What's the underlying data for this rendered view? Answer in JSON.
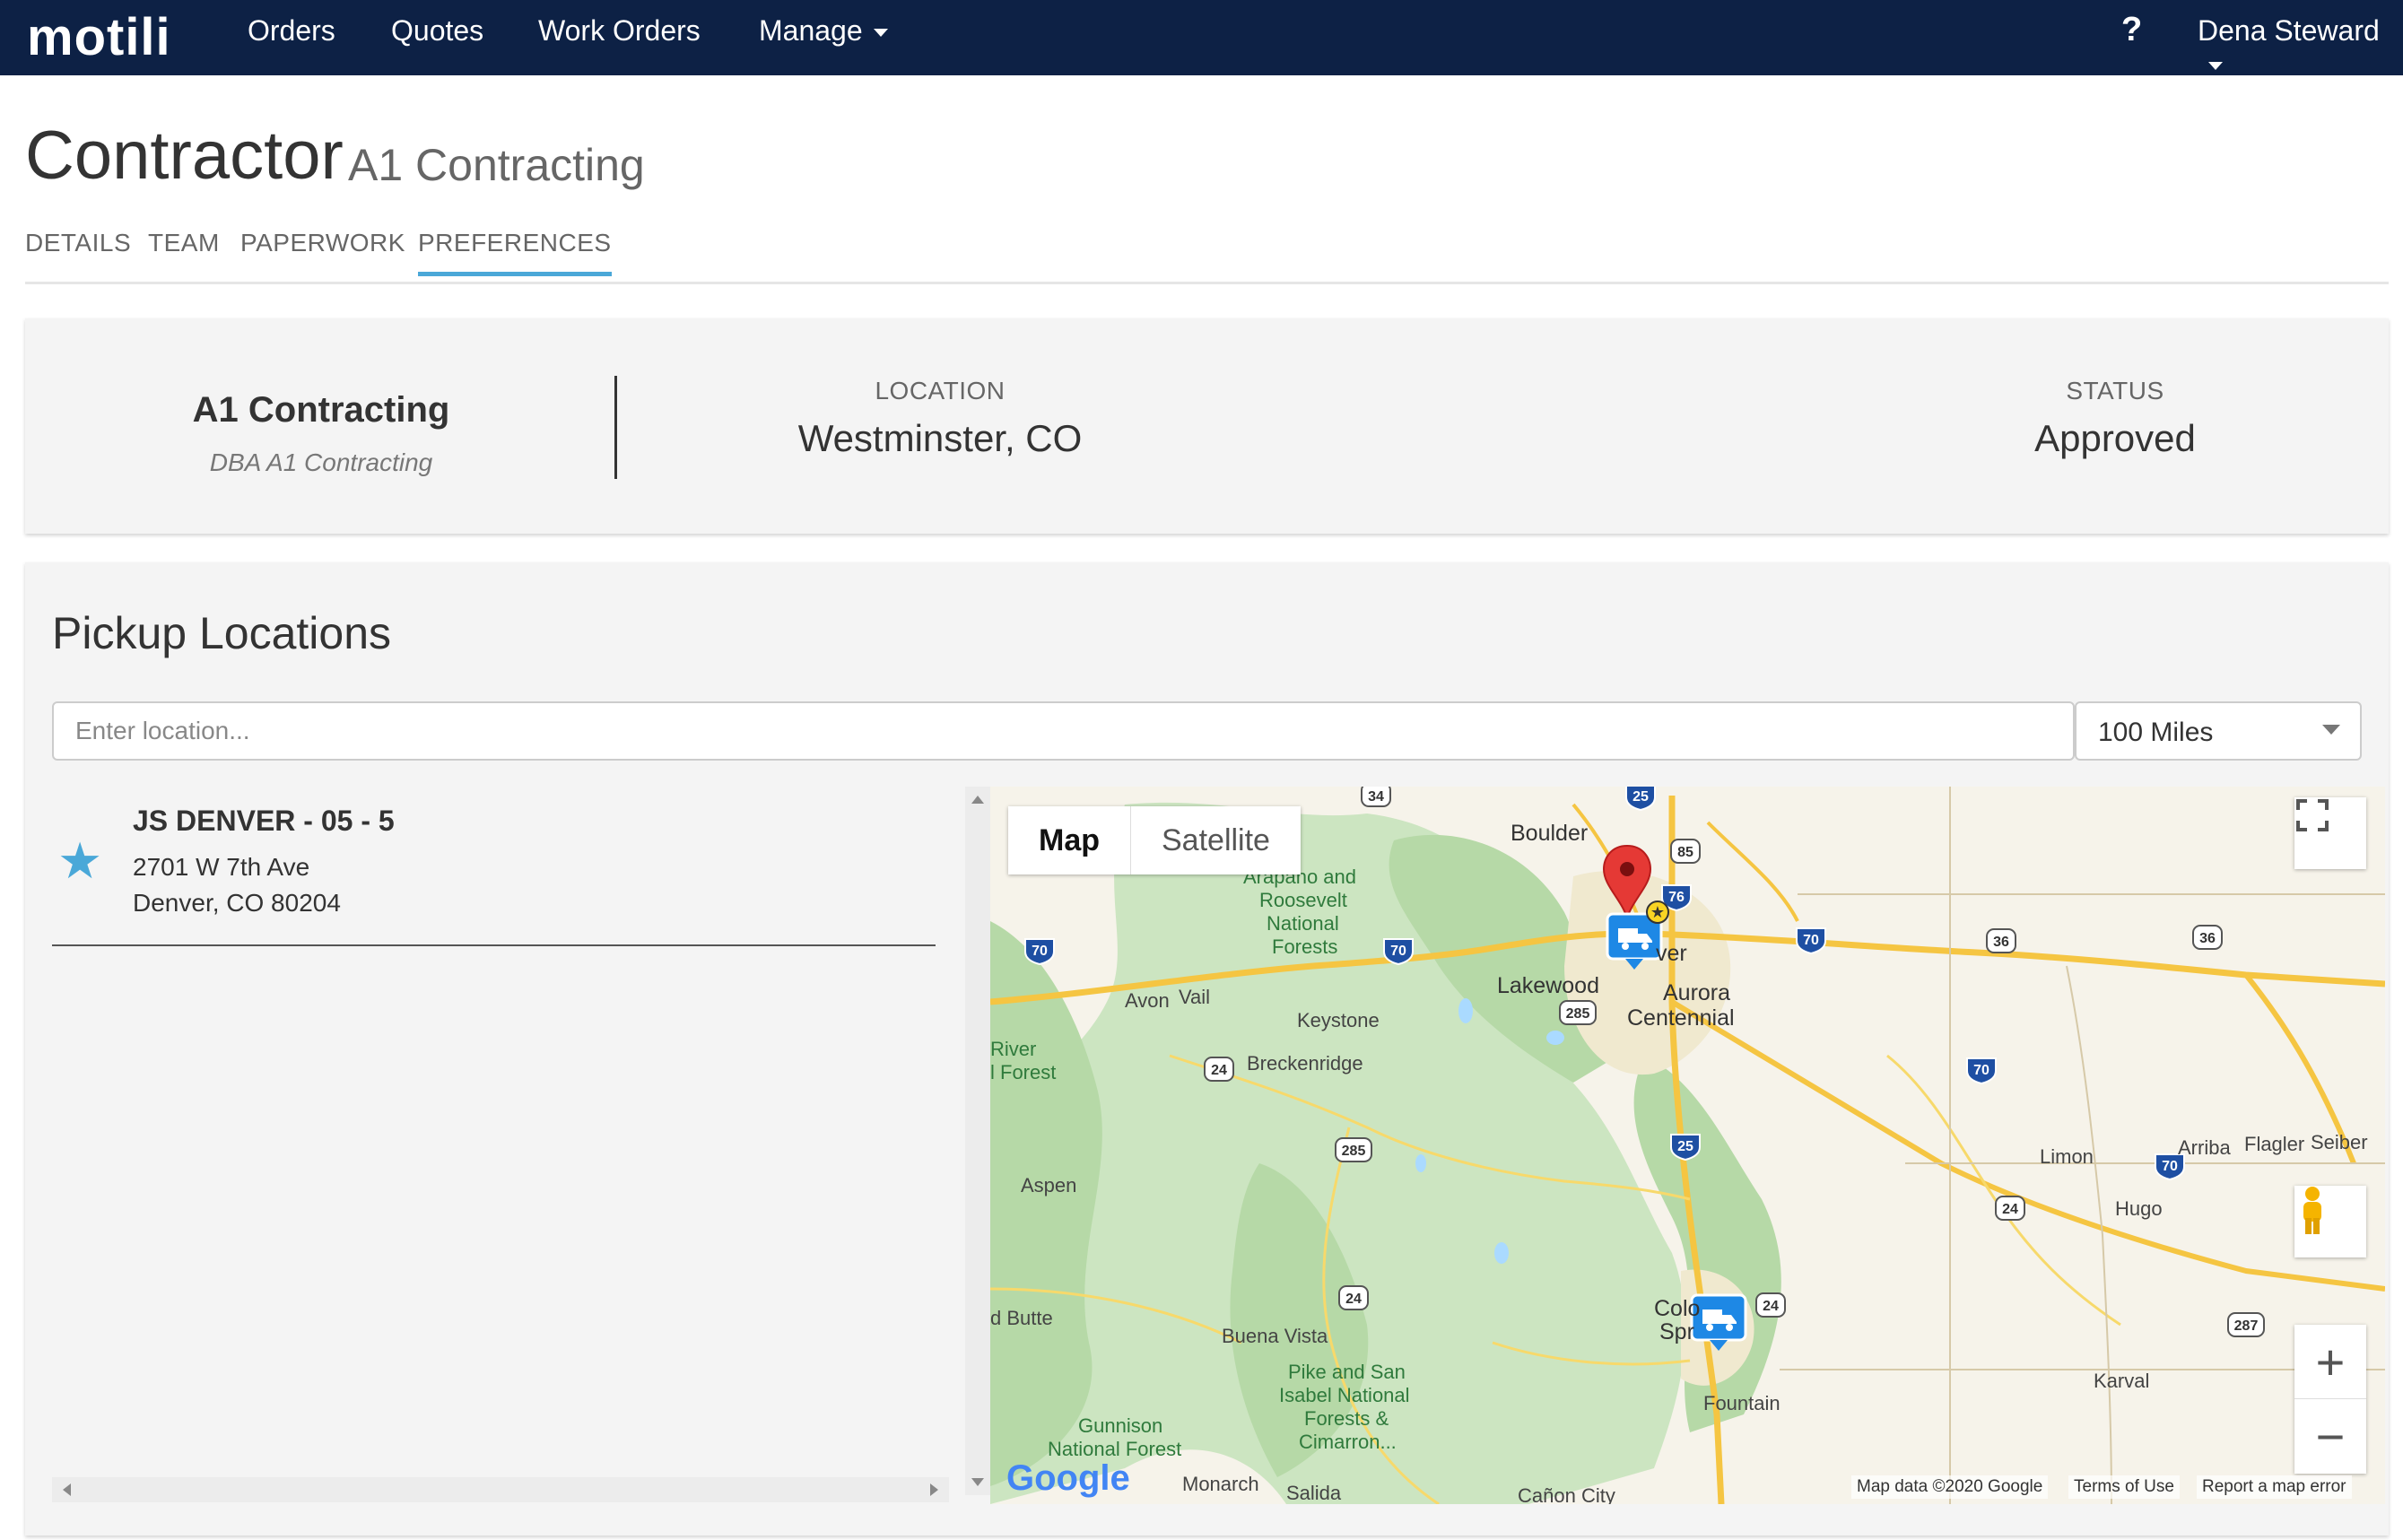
{
  "nav": {
    "logo": "motili",
    "items": [
      "Orders",
      "Quotes",
      "Work Orders",
      "Manage"
    ],
    "help": "?",
    "user": "Dena Steward"
  },
  "header": {
    "title": "Contractor",
    "subtitle": "A1 Contracting"
  },
  "tabs": [
    "DETAILS",
    "TEAM",
    "PAPERWORK",
    "PREFERENCES"
  ],
  "summary": {
    "name": "A1 Contracting",
    "dba": "DBA A1 Contracting",
    "location_label": "LOCATION",
    "location_value": "Westminster, CO",
    "status_label": "STATUS",
    "status_value": "Approved"
  },
  "pickup": {
    "title": "Pickup Locations",
    "search_placeholder": "Enter location...",
    "radius": "100 Miles",
    "items": [
      {
        "name": "JS DENVER - 05 - 5",
        "address1": "2701 W 7th Ave",
        "address2": "Denver, CO 80204"
      }
    ]
  },
  "map": {
    "type_map": "Map",
    "type_satellite": "Satellite",
    "google": "Google",
    "footer_data": "Map data ©2020 Google",
    "footer_terms": "Terms of Use",
    "footer_report": "Report a map error",
    "labels": {
      "boulder": "Boulder",
      "arapaho": "Arapaho and",
      "roosevelt": "Roosevelt",
      "national": "National",
      "forests": "Forests",
      "lakewood": "Lakewood",
      "denver": "ver",
      "aurora": "Aurora",
      "centennial": "Centennial",
      "avon": "Avon",
      "vail": "Vail",
      "keystone": "Keystone",
      "breckenridge": "Breckenridge",
      "river": "River",
      "forest": "l Forest",
      "aspen": "Aspen",
      "butte": "d Butte",
      "buena_vista": "Buena Vista",
      "pike1": "Pike and San",
      "pike2": "Isabel National",
      "pike3": "Forests &",
      "pike4": "Cimarron...",
      "gunnison1": "Gunnison",
      "gunnison2": "National Forest",
      "monarch": "Monarch",
      "salida": "Salida",
      "canon": "Cañon City",
      "fountain": "Fountain",
      "colo": "Colo",
      "spr": "Spr",
      "limon": "Limon",
      "arriba": "Arriba",
      "flagler": "Flagler",
      "seibert": "Seiber",
      "hugo": "Hugo",
      "karval": "Karval"
    },
    "shields": [
      "25",
      "85",
      "76",
      "70",
      "70",
      "70",
      "36",
      "36",
      "24",
      "285",
      "285",
      "70",
      "25",
      "24",
      "24",
      "24",
      "287",
      "34"
    ]
  },
  "colors": {
    "navbar": "#0d2145",
    "accent": "#4aa8d8",
    "marker_red": "#e53935",
    "marker_blue": "#1e88e5"
  }
}
